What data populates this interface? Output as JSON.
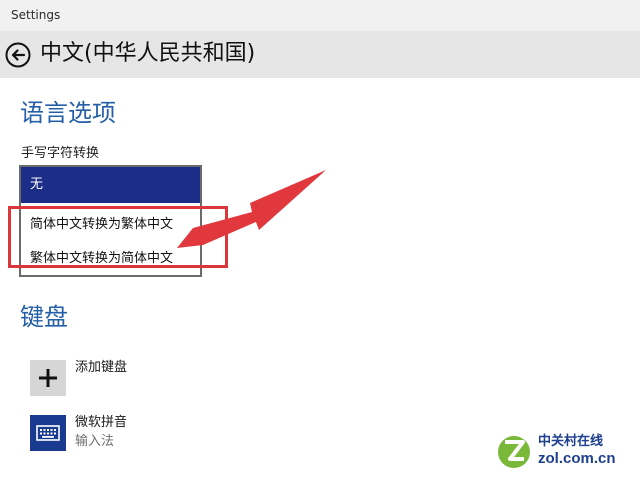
{
  "window": {
    "title": "Settings"
  },
  "header": {
    "title": "中文(中华人民共和国)"
  },
  "language_options": {
    "section_title": "语言选项",
    "handwriting": {
      "label": "手写字符转换",
      "options": [
        "无",
        "简体中文转换为繁体中文",
        "繁体中文转换为简体中文"
      ],
      "selected": "无"
    }
  },
  "keyboard": {
    "section_title": "键盘",
    "add_keyboard_label": "添加键盘",
    "items": [
      {
        "name": "微软拼音",
        "type": "输入法"
      }
    ]
  },
  "watermark": {
    "line1": "中关村在线",
    "line2": "zol.com.cn"
  },
  "colors": {
    "accent_blue": "#245fa8",
    "selected_bg": "#1b2d87",
    "annotation_red": "#d9373c"
  }
}
